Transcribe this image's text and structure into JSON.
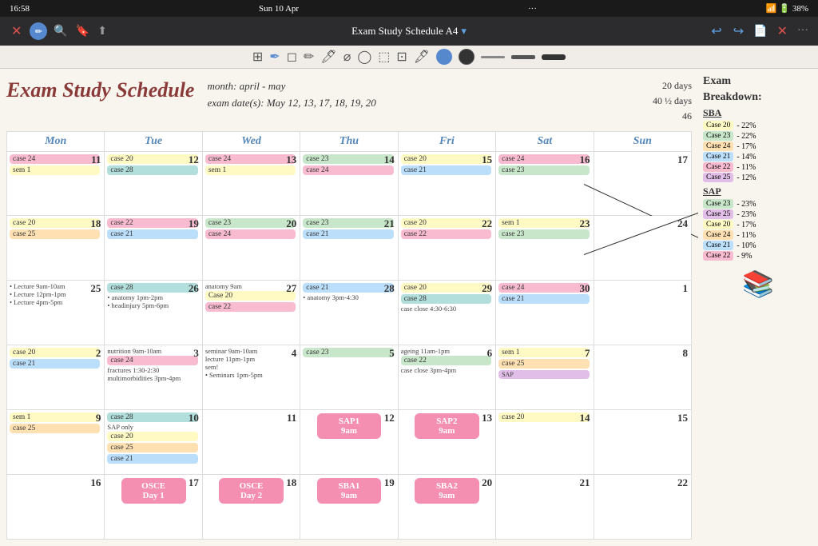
{
  "status_bar": {
    "time": "16:58",
    "date": "Sun 10 Apr",
    "dots": "···",
    "battery": "38%",
    "wifi": "▾"
  },
  "toolbar": {
    "title": "Exam Study Schedule A4",
    "title_suffix": "▾",
    "undo": "↩",
    "redo": "↪",
    "share": "⬜",
    "close": "✕",
    "more": "···",
    "back": "✕",
    "bookmark": "🔖",
    "search": "🔍",
    "export": "⬆"
  },
  "header": {
    "title": "Exam Study Schedule",
    "month_label": "month:",
    "month_value": "april - may",
    "exam_label": "exam date(s):",
    "exam_value": "May 12, 13, 17, 18, 19, 20",
    "stats": [
      "20 days",
      "40 ½ days",
      "46"
    ]
  },
  "days": [
    "Mon",
    "Tue",
    "Wed",
    "Thu",
    "Fri",
    "Sat",
    "Sun"
  ],
  "sidebar": {
    "title": "Exam",
    "subtitle": "Breakdown:",
    "sba_title": "SBA",
    "sba_items": [
      {
        "label": "Case 20",
        "pct": "22%",
        "color": "tag-yellow"
      },
      {
        "label": "Case 23",
        "pct": "22%",
        "color": "tag-green"
      },
      {
        "label": "Case 24",
        "pct": "17%",
        "color": "tag-orange"
      },
      {
        "label": "Case 21",
        "pct": "14%",
        "color": "tag-blue"
      },
      {
        "label": "Case 22",
        "pct": "11%",
        "color": "tag-pink"
      },
      {
        "label": "Case 25",
        "pct": "12%",
        "color": "tag-purple"
      }
    ],
    "sap_title": "SAP",
    "sap_items": [
      {
        "label": "Case 23",
        "pct": "23%",
        "color": "tag-green"
      },
      {
        "label": "Case 25",
        "pct": "23%",
        "color": "tag-purple"
      },
      {
        "label": "Case 20",
        "pct": "17%",
        "color": "tag-yellow"
      },
      {
        "label": "Case 24",
        "pct": "11%",
        "color": "tag-orange"
      },
      {
        "label": "Case 21",
        "pct": "10%",
        "color": "tag-blue"
      },
      {
        "label": "Case 22",
        "pct": "9%",
        "color": "tag-pink"
      }
    ]
  }
}
